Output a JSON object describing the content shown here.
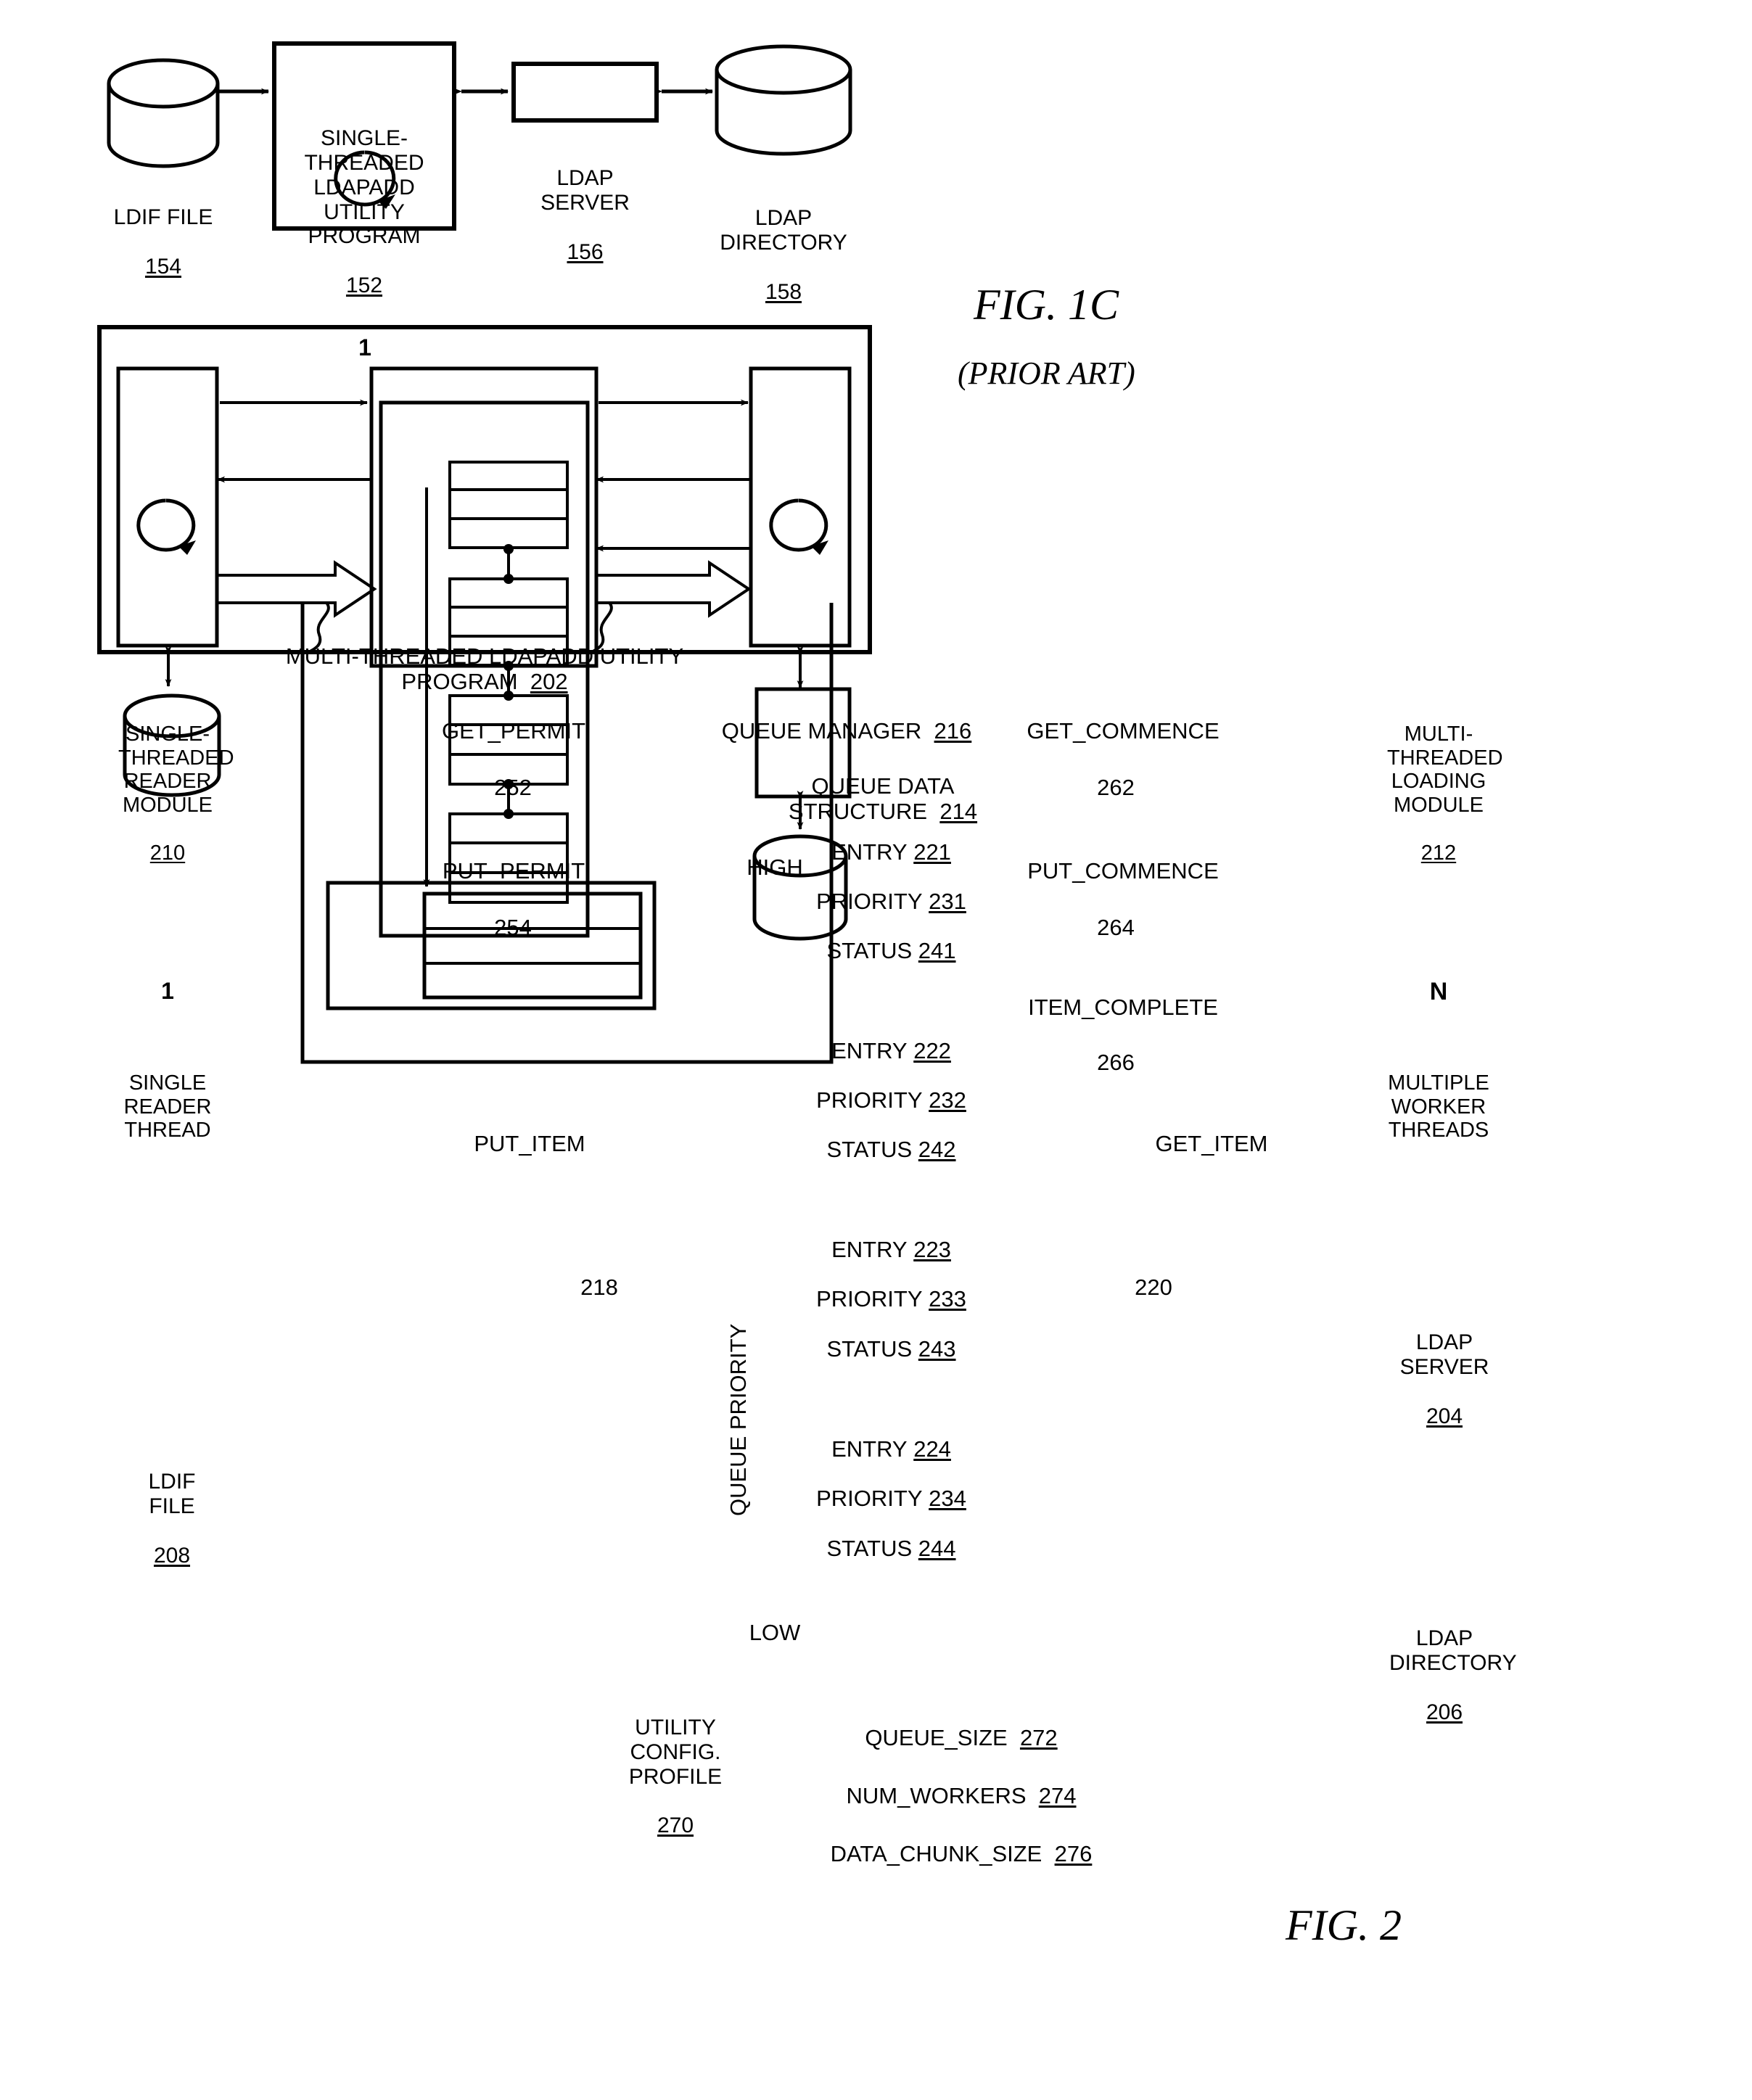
{
  "figures": [
    {
      "id": "fig1c",
      "caption": "FIG. 1C",
      "subcaption": "(PRIOR ART)",
      "nodes": {
        "ldif_file": {
          "label": "LDIF FILE",
          "ref": "154"
        },
        "utility_program": {
          "label": "SINGLE-THREADED\nLDAPADD\nUTILITY PROGRAM",
          "ref": "152",
          "thread_count": "1"
        },
        "ldap_server": {
          "label": "LDAP SERVER",
          "ref": "156"
        },
        "ldap_directory": {
          "label": "LDAP\nDIRECTORY",
          "ref": "158"
        }
      }
    },
    {
      "id": "fig2",
      "caption": "FIG. 2",
      "title": "MULTI-THREADED LDAPADD UTILITY PROGRAM",
      "title_ref": "202",
      "nodes": {
        "reader_module": {
          "label": "SINGLE-\nTHREADED\nREADER\nMODULE",
          "ref": "210",
          "thread_count": "1",
          "thread_label": "SINGLE\nREADER\nTHREAD"
        },
        "queue_manager": {
          "label": "QUEUE MANAGER",
          "ref": "216"
        },
        "queue_data_structure": {
          "label": "QUEUE DATA\nSTRUCTURE",
          "ref": "214"
        },
        "loading_module": {
          "label": "MULTI-\nTHREADED\nLOADING\nMODULE",
          "ref": "212",
          "thread_count": "N",
          "thread_label": "MULTIPLE\nWORKER\nTHREADS"
        },
        "ldif_file": {
          "label": "LDIF FILE",
          "ref": "208"
        },
        "ldap_server": {
          "label": "LDAP\nSERVER",
          "ref": "204"
        },
        "ldap_directory": {
          "label": "LDAP\nDIRECTORY",
          "ref": "206"
        },
        "utility_config_profile": {
          "label": "UTILITY\nCONFIG.\nPROFILE",
          "ref": "270"
        }
      },
      "priority_axis": {
        "high": "HIGH",
        "low": "LOW",
        "axis_label": "QUEUE PRIORITY"
      },
      "queue_entries": [
        {
          "entry": "ENTRY",
          "entry_ref": "221",
          "priority": "PRIORITY",
          "priority_ref": "231",
          "status": "STATUS",
          "status_ref": "241"
        },
        {
          "entry": "ENTRY",
          "entry_ref": "222",
          "priority": "PRIORITY",
          "priority_ref": "232",
          "status": "STATUS",
          "status_ref": "242"
        },
        {
          "entry": "ENTRY",
          "entry_ref": "223",
          "priority": "PRIORITY",
          "priority_ref": "233",
          "status": "STATUS",
          "status_ref": "243"
        },
        {
          "entry": "ENTRY",
          "entry_ref": "224",
          "priority": "PRIORITY",
          "priority_ref": "234",
          "status": "STATUS",
          "status_ref": "244"
        }
      ],
      "signals": [
        {
          "name": "GET_PERMIT",
          "ref": "252"
        },
        {
          "name": "PUT_PERMIT",
          "ref": "254"
        },
        {
          "name": "GET_COMMENCE",
          "ref": "262"
        },
        {
          "name": "PUT_COMMENCE",
          "ref": "264"
        },
        {
          "name": "ITEM_COMPLETE",
          "ref": "266"
        },
        {
          "name": "PUT_ITEM",
          "ref": "218"
        },
        {
          "name": "GET_ITEM",
          "ref": "220"
        }
      ],
      "config_params": [
        {
          "name": "QUEUE_SIZE",
          "ref": "272"
        },
        {
          "name": "NUM_WORKERS",
          "ref": "274"
        },
        {
          "name": "DATA_CHUNK_SIZE",
          "ref": "276"
        }
      ]
    }
  ]
}
